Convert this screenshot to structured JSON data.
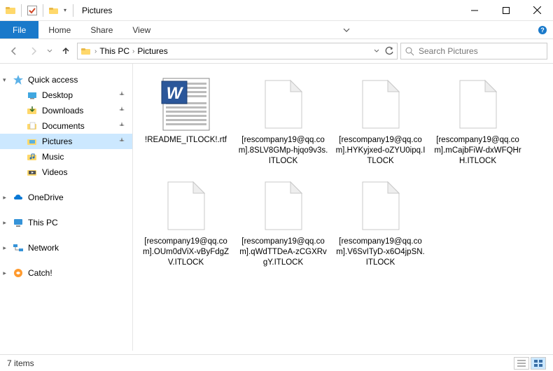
{
  "titlebar": {
    "title": "Pictures"
  },
  "ribbon": {
    "file": "File",
    "tabs": [
      "Home",
      "Share",
      "View"
    ]
  },
  "breadcrumb": {
    "items": [
      "This PC",
      "Pictures"
    ]
  },
  "search": {
    "placeholder": "Search Pictures"
  },
  "sidebar": {
    "quick_access": {
      "label": "Quick access",
      "items": [
        {
          "label": "Desktop",
          "pinned": true
        },
        {
          "label": "Downloads",
          "pinned": true
        },
        {
          "label": "Documents",
          "pinned": true
        },
        {
          "label": "Pictures",
          "pinned": true,
          "active": true
        },
        {
          "label": "Music",
          "pinned": false
        },
        {
          "label": "Videos",
          "pinned": false
        }
      ]
    },
    "onedrive": {
      "label": "OneDrive"
    },
    "thispc": {
      "label": "This PC"
    },
    "network": {
      "label": "Network"
    },
    "catch": {
      "label": "Catch!"
    }
  },
  "files": [
    {
      "name": "!README_ITLOCK!.rtf",
      "type": "rtf"
    },
    {
      "name": "[rescompany19@qq.com].8SLV8GMp-hjqo9v3s.ITLOCK",
      "type": "unknown"
    },
    {
      "name": "[rescompany19@qq.com].HYKyjxed-oZYU0ipq.ITLOCK",
      "type": "unknown"
    },
    {
      "name": "[rescompany19@qq.com].mCajbFiW-dxWFQHrH.ITLOCK",
      "type": "unknown"
    },
    {
      "name": "[rescompany19@qq.com].OUm0dViX-vByFdgZV.ITLOCK",
      "type": "unknown"
    },
    {
      "name": "[rescompany19@qq.com].qWdTTDeA-zCGXRvgY.ITLOCK",
      "type": "unknown"
    },
    {
      "name": "[rescompany19@qq.com].V6SvITyD-x6O4jpSN.ITLOCK",
      "type": "unknown"
    }
  ],
  "status": {
    "count_label": "7 items"
  },
  "colors": {
    "accent": "#1979ca",
    "selection": "#cce8ff"
  }
}
